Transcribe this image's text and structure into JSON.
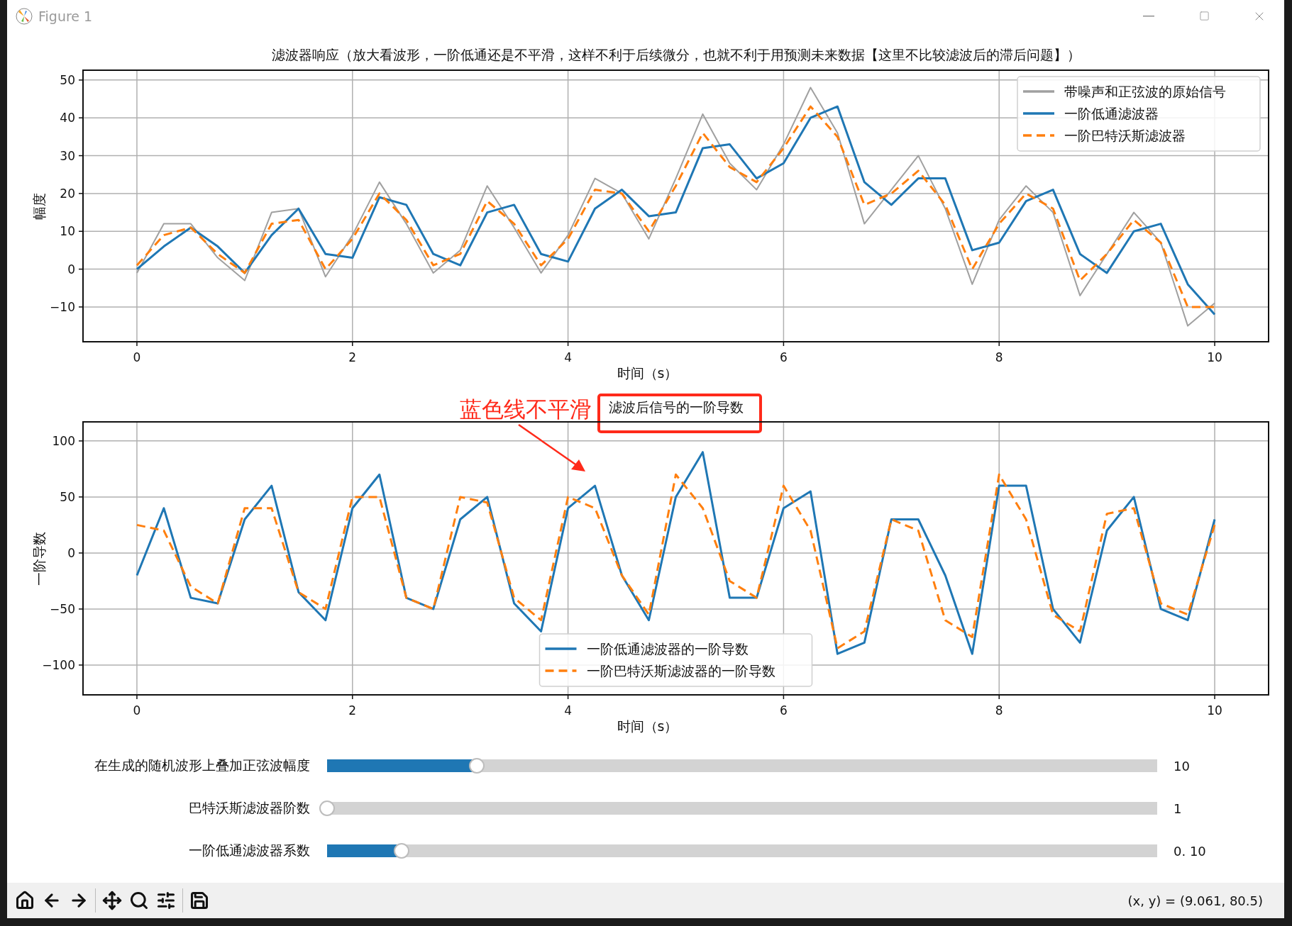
{
  "window": {
    "title": "Figure 1"
  },
  "plots": [
    {
      "title": "滤波器响应（放大看波形，一阶低通还是不平滑，这样不利于后续微分，也就不利于用预测未来数据【这里不比较滤波后的滞后问题】）",
      "highlighted": false,
      "chart_data": {
        "type": "line",
        "xlabel": "时间（s）",
        "ylabel": "幅度",
        "xlim": [
          -0.5,
          10.5
        ],
        "ylim": [
          -19.2,
          52.6
        ],
        "xticks": [
          0,
          2,
          4,
          6,
          8,
          10
        ],
        "yticks": [
          {
            "value": -10,
            "label": "−10"
          },
          0,
          10,
          20,
          30,
          40,
          50
        ],
        "grid": true,
        "legend": true,
        "x": [
          0,
          0.25,
          0.5,
          0.75,
          1,
          1.25,
          1.5,
          1.75,
          2,
          2.25,
          2.5,
          2.75,
          3,
          3.25,
          3.5,
          3.75,
          4,
          4.25,
          4.5,
          4.75,
          5,
          5.25,
          5.5,
          5.75,
          6,
          6.25,
          6.5,
          6.75,
          7,
          7.25,
          7.5,
          7.75,
          8,
          8.25,
          8.5,
          8.75,
          9,
          9.25,
          9.5,
          9.75,
          10
        ],
        "series": [
          {
            "name": "带噪声和正弦波的原始信号",
            "color": "#a0a0a0",
            "line_style": "solid",
            "values": [
              -1,
              12,
              12,
              3,
              -3,
              15,
              16,
              -2,
              9,
              23,
              12,
              -1,
              5,
              22,
              11,
              -1,
              9,
              24,
              20,
              8,
              24,
              41,
              28,
              21,
              33,
              48,
              36,
              12,
              21,
              30,
              16,
              -4,
              13,
              22,
              15,
              -7,
              4,
              15,
              7,
              -15,
              -9
            ]
          },
          {
            "name": "一阶低通滤波器",
            "color": "#1f77b4",
            "line_style": "solid",
            "values": [
              0,
              6,
              11,
              6,
              -1,
              9,
              16,
              4,
              3,
              19,
              17,
              4,
              1,
              15,
              17,
              4,
              2,
              16,
              21,
              14,
              15,
              32,
              33,
              24,
              28,
              40,
              43,
              23,
              17,
              24,
              24,
              5,
              7,
              18,
              21,
              4,
              -1,
              10,
              12,
              -4,
              -12
            ]
          },
          {
            "name": "一阶巴特沃斯滤波器",
            "color": "#ff7f0e",
            "line_style": "dashed",
            "values": [
              1,
              9,
              11,
              4,
              -1,
              12,
              13,
              0,
              8,
              20,
              13,
              1,
              4,
              18,
              12,
              1,
              8,
              21,
              20,
              10,
              22,
              36,
              27,
              23,
              32,
              43,
              35,
              17,
              20,
              26,
              17,
              0,
              12,
              20,
              16,
              -3,
              4,
              13,
              7,
              -10,
              -10
            ]
          }
        ]
      }
    },
    {
      "title": "滤波后信号的一阶导数",
      "highlighted": true,
      "chart_data": {
        "type": "line",
        "xlabel": "时间（s）",
        "ylabel": "一阶导数",
        "xlim": [
          -0.5,
          10.5
        ],
        "ylim": [
          -126.6,
          117
        ],
        "xticks": [
          0,
          2,
          4,
          6,
          8,
          10
        ],
        "yticks": [
          {
            "value": -100,
            "label": "−100"
          },
          {
            "value": -50,
            "label": "−50"
          },
          0,
          50,
          100
        ],
        "grid": true,
        "legend": true,
        "x": [
          0,
          0.25,
          0.5,
          0.75,
          1,
          1.25,
          1.5,
          1.75,
          2,
          2.25,
          2.5,
          2.75,
          3,
          3.25,
          3.5,
          3.75,
          4,
          4.25,
          4.5,
          4.75,
          5,
          5.25,
          5.5,
          5.75,
          6,
          6.25,
          6.5,
          6.75,
          7,
          7.25,
          7.5,
          7.75,
          8,
          8.25,
          8.5,
          8.75,
          9,
          9.25,
          9.5,
          9.75,
          10
        ],
        "series": [
          {
            "name": "一阶低通滤波器的一阶导数",
            "color": "#1f77b4",
            "line_style": "solid",
            "values": [
              -20,
              40,
              -40,
              -45,
              30,
              60,
              -35,
              -60,
              40,
              70,
              -40,
              -50,
              30,
              50,
              -45,
              -70,
              40,
              60,
              -20,
              -60,
              50,
              90,
              -40,
              -40,
              40,
              55,
              -90,
              -80,
              30,
              30,
              -20,
              -90,
              60,
              60,
              -50,
              -80,
              20,
              50,
              -50,
              -60,
              30
            ]
          },
          {
            "name": "一阶巴特沃斯滤波器的一阶导数",
            "color": "#ff7f0e",
            "line_style": "dashed",
            "values": [
              25,
              20,
              -30,
              -45,
              40,
              40,
              -35,
              -50,
              50,
              50,
              -40,
              -50,
              50,
              45,
              -40,
              -60,
              50,
              40,
              -20,
              -55,
              70,
              40,
              -25,
              -40,
              60,
              20,
              -85,
              -70,
              30,
              20,
              -60,
              -75,
              70,
              30,
              -55,
              -70,
              35,
              40,
              -45,
              -55,
              25
            ]
          }
        ]
      }
    }
  ],
  "annotation": {
    "text": "蓝色线不平滑"
  },
  "sliders": [
    {
      "label": "在生成的随机波形上叠加正弦波幅度",
      "value": "10",
      "level": 0.18
    },
    {
      "label": "巴特沃斯滤波器阶数",
      "value": "1",
      "level": 0
    },
    {
      "label": "一阶低通滤波器系数",
      "value": "0. 10",
      "level": 0.09
    }
  ],
  "toolbar": {
    "coordinates": "(x, y) = (9.061, 80.5)"
  }
}
